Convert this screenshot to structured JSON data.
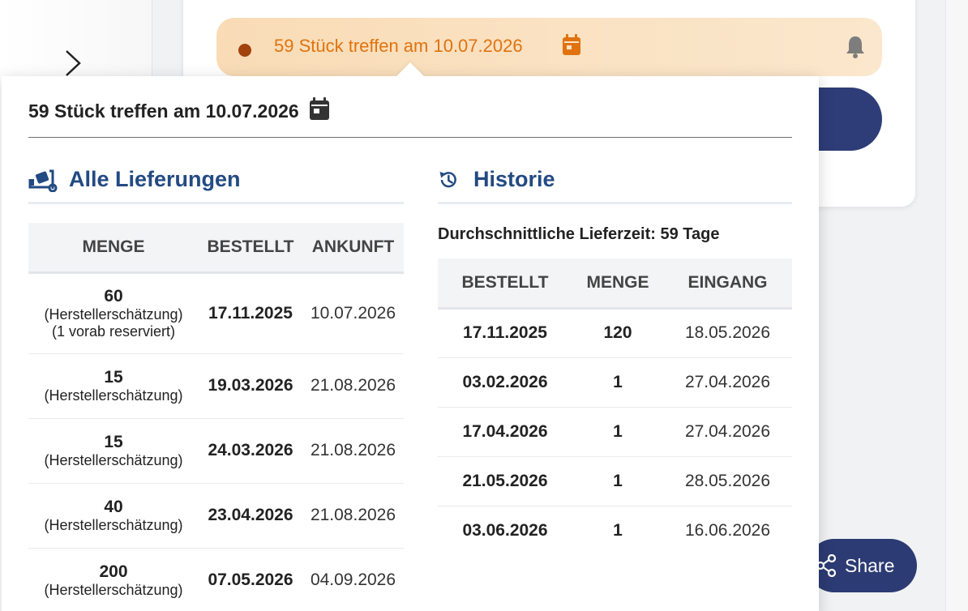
{
  "status": {
    "text": "59 Stück treffen am 10.07.2026",
    "dot_color": "#a2430e",
    "text_color": "#e0730f",
    "calendar_icon": "calendar-icon",
    "bell_icon": "bell-icon"
  },
  "share": {
    "label": "Share",
    "icon": "share-icon"
  },
  "popover": {
    "title": "59 Stück treffen am 10.07.2026",
    "deliveries": {
      "title": "Alle Lieferungen",
      "icon": "truck-icon",
      "headers": [
        "MENGE",
        "BESTELLT",
        "ANKUNFT"
      ],
      "rows": [
        {
          "qty": "60",
          "note": "(Herstellerschätzung)",
          "note2": "(1 vorab reserviert)",
          "ordered": "17.11.2025",
          "arrival": "10.07.2026"
        },
        {
          "qty": "15",
          "note": "(Herstellerschätzung)",
          "note2": "",
          "ordered": "19.03.2026",
          "arrival": "21.08.2026"
        },
        {
          "qty": "15",
          "note": "(Herstellerschätzung)",
          "note2": "",
          "ordered": "24.03.2026",
          "arrival": "21.08.2026"
        },
        {
          "qty": "40",
          "note": "(Herstellerschätzung)",
          "note2": "",
          "ordered": "23.04.2026",
          "arrival": "21.08.2026"
        },
        {
          "qty": "200",
          "note": "(Herstellerschätzung)",
          "note2": "",
          "ordered": "07.05.2026",
          "arrival": "04.09.2026"
        }
      ]
    },
    "history": {
      "title": "Historie",
      "icon": "history-icon",
      "average": "Durchschnittliche Lieferzeit: 59 Tage",
      "headers": [
        "BESTELLT",
        "MENGE",
        "EINGANG"
      ],
      "rows": [
        {
          "ordered": "17.11.2025",
          "qty": "120",
          "received": "18.05.2026"
        },
        {
          "ordered": "03.02.2026",
          "qty": "1",
          "received": "27.04.2026"
        },
        {
          "ordered": "17.04.2026",
          "qty": "1",
          "received": "27.04.2026"
        },
        {
          "ordered": "21.05.2026",
          "qty": "1",
          "received": "28.05.2026"
        },
        {
          "ordered": "03.06.2026",
          "qty": "1",
          "received": "16.06.2026"
        }
      ]
    }
  },
  "colors": {
    "accent_navy": "#2e3d78",
    "section_title": "#234a82",
    "status_bg": "#f9dcb6"
  }
}
